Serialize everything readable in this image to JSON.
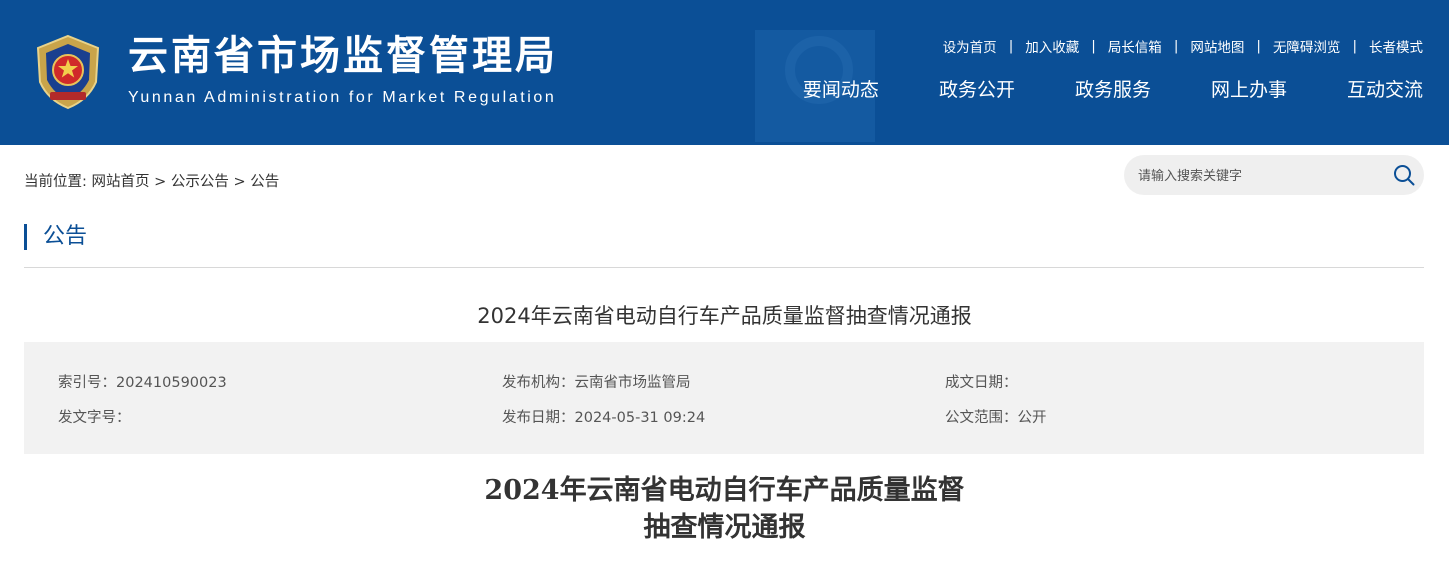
{
  "header": {
    "title": "云南省市场监督管理局",
    "subtitle": "Yunnan Administration for Market Regulation",
    "top_links": [
      "设为首页",
      "加入收藏",
      "局长信箱",
      "网站地图",
      "无障碍浏览",
      "长者模式"
    ],
    "nav": [
      "要闻动态",
      "政务公开",
      "政务服务",
      "网上办事",
      "互动交流"
    ],
    "brand_color": "#0b4f96"
  },
  "breadcrumb": {
    "prefix": "当前位置: ",
    "items": [
      "网站首页",
      "公示公告",
      "公告"
    ],
    "separator": " > "
  },
  "search": {
    "placeholder": "请输入搜索关键字",
    "icon": "search-icon"
  },
  "section": {
    "title": "公告"
  },
  "article": {
    "title": "2024年云南省电动自行车产品质量监督抽查情况通报",
    "meta": {
      "index_label": "索引号：",
      "index_value": "202410590023",
      "issuer_label": "发布机构：",
      "issuer_value": "云南省市场监管局",
      "formed_label": "成文日期：",
      "formed_value": "",
      "docno_label": "发文字号：",
      "docno_value": "",
      "pubdate_label": "发布日期：",
      "pubdate_value": "2024-05-31 09:24",
      "scope_label": "公文范围：",
      "scope_value": "公开"
    },
    "doc_title_line1": "2024年云南省电动自行车产品质量监督",
    "doc_title_line2": "抽查情况通报"
  }
}
